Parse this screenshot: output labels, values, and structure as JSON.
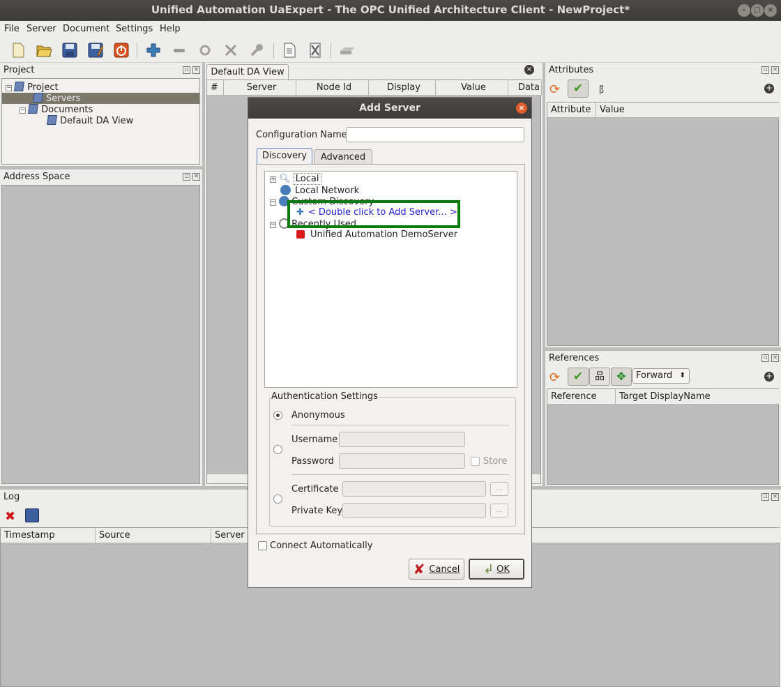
{
  "window": {
    "title": "Unified Automation UaExpert - The OPC Unified Architecture Client - NewProject*"
  },
  "menu": [
    "File",
    "Server",
    "Document",
    "Settings",
    "Help"
  ],
  "project_panel": {
    "title": "Project",
    "tree": {
      "root": "Project",
      "servers": "Servers",
      "documents": "Documents",
      "default_view": "Default DA View"
    }
  },
  "address_panel": {
    "title": "Address Space"
  },
  "da_view": {
    "tab": "Default DA View",
    "columns": [
      "#",
      "Server",
      "Node Id",
      "Display Name",
      "Value",
      "Data"
    ]
  },
  "attributes_panel": {
    "title": "Attributes",
    "columns": [
      "Attribute",
      "Value"
    ]
  },
  "references_panel": {
    "title": "References",
    "direction": "Forward",
    "columns": [
      "Reference",
      "Target DisplayName"
    ]
  },
  "log_panel": {
    "title": "Log",
    "columns": [
      "Timestamp",
      "Source",
      "Server"
    ]
  },
  "dialog": {
    "title": "Add Server",
    "config_name_label": "Configuration Name",
    "config_name_value": "",
    "tabs": [
      "Discovery",
      "Advanced"
    ],
    "tree": {
      "local": "Local",
      "local_network": "Local Network",
      "custom_discovery": "Custom Discovery",
      "add_server": "< Double click to Add Server... >",
      "recently_used": "Recently Used",
      "demo_server": "Unified Automation DemoServer"
    },
    "auth": {
      "group_title": "Authentication Settings",
      "anonymous": "Anonymous",
      "username": "Username",
      "password": "Password",
      "store": "Store",
      "certificate": "Certificate",
      "private_key": "Private Key",
      "browse": "..."
    },
    "connect_auto": "Connect Automatically",
    "cancel": "Cancel",
    "ok": "OK"
  },
  "colors": {
    "highlight_box": "#0a7a0a",
    "selected_row": "#7b7769",
    "link_text": "#2020d0"
  }
}
